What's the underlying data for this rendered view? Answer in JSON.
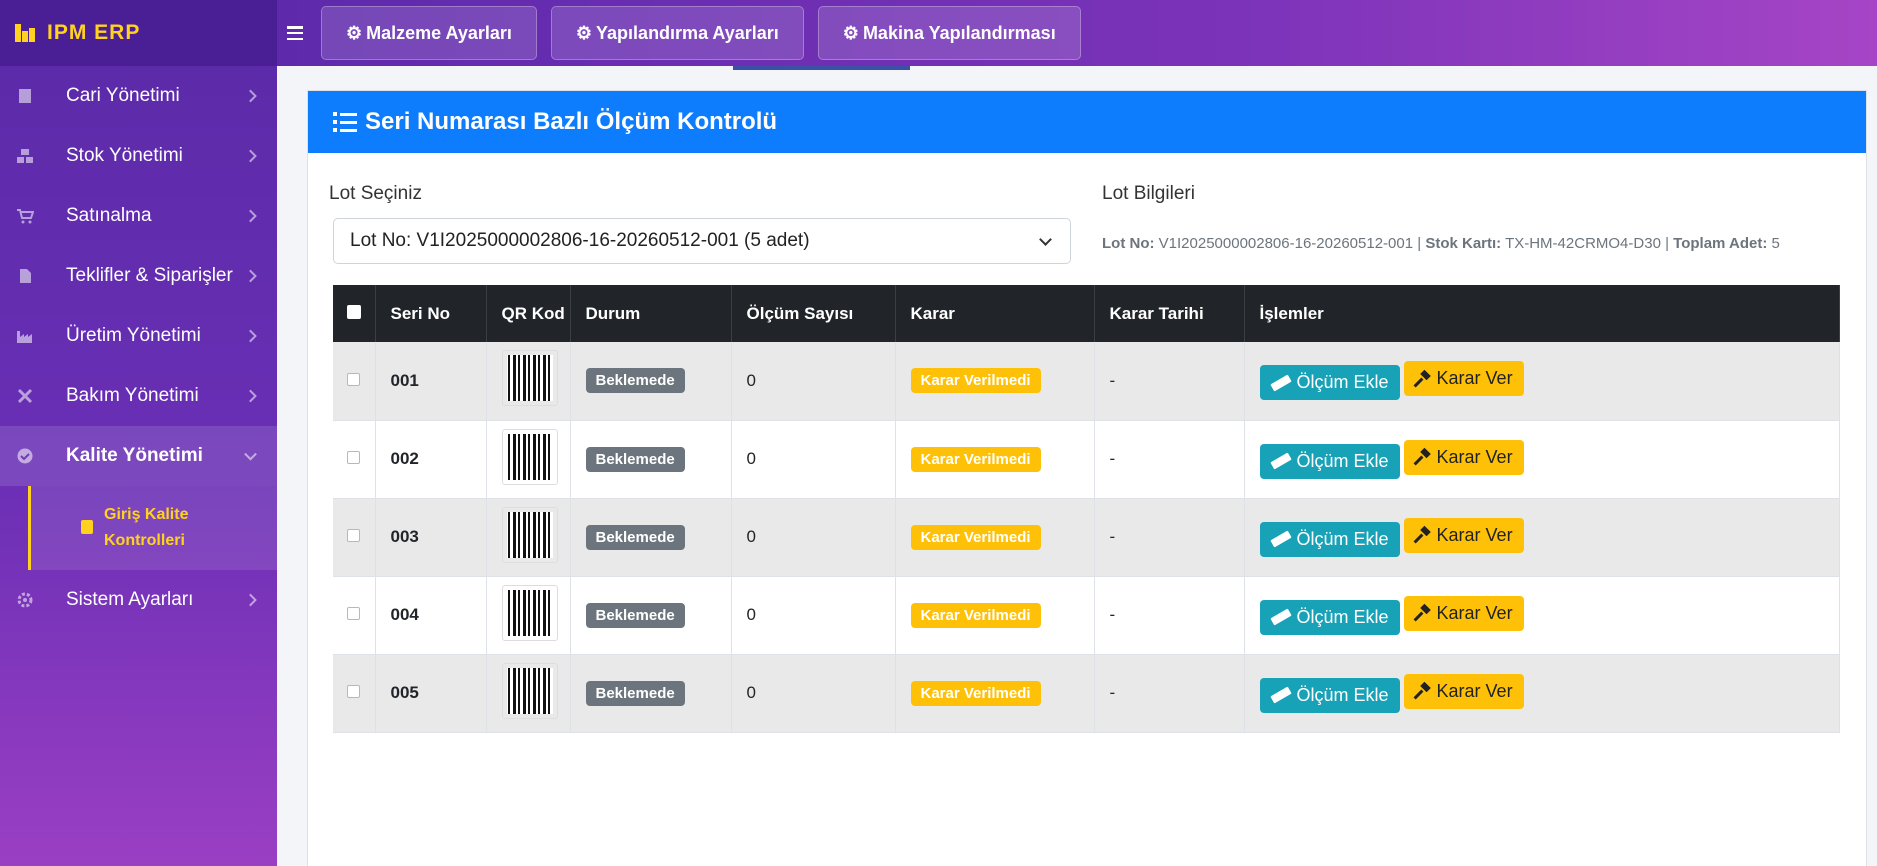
{
  "brand": {
    "name": "IPM ERP"
  },
  "topbar": {
    "buttons": [
      {
        "label": "Malzeme Ayarları",
        "icon": "users-gear-icon"
      },
      {
        "label": "Yapılandırma Ayarları",
        "icon": "gear-icon"
      },
      {
        "label": "Makina Yapılandırması",
        "icon": "gears-icon"
      }
    ]
  },
  "sidebar": {
    "items": [
      {
        "label": "Cari Yönetimi",
        "icon": "building-icon"
      },
      {
        "label": "Stok Yönetimi",
        "icon": "boxes-icon"
      },
      {
        "label": "Satınalma",
        "icon": "cart-icon"
      },
      {
        "label": "Teklifler & Siparişler",
        "icon": "document-icon"
      },
      {
        "label": "Üretim Yönetimi",
        "icon": "factory-icon"
      },
      {
        "label": "Bakım Yönetimi",
        "icon": "tools-icon"
      },
      {
        "label": "Kalite Yönetimi",
        "icon": "check-circle-icon"
      },
      {
        "label": "Sistem Ayarları",
        "icon": "gear-icon"
      }
    ],
    "submenu": {
      "label": "Giriş Kalite Kontrolleri",
      "icon": "clipboard-check-icon"
    }
  },
  "card": {
    "title": "Seri Numarası Bazlı Ölçüm Kontrolü",
    "lot_select_label": "Lot Seçiniz",
    "lot_select_value": "Lot No: V1I2025000002806-16-20260512-001 (5 adet)",
    "lot_info_label": "Lot Bilgileri",
    "lot_info": {
      "lot_no_label": "Lot No:",
      "lot_no": "V1I2025000002806-16-20260512-001",
      "stock_label": "Stok Kartı:",
      "stock": "TX-HM-42CRMO4-D30",
      "total_label": "Toplam Adet:",
      "total": "5",
      "sep": "|"
    }
  },
  "table": {
    "headers": [
      "Seri No",
      "QR Kod",
      "Durum",
      "Ölçüm Sayısı",
      "Karar",
      "Karar Tarihi",
      "İşlemler"
    ],
    "rows": [
      {
        "serial": "001",
        "status": "Beklemede",
        "count": "0",
        "decision": "Karar Verilmedi",
        "date": "-"
      },
      {
        "serial": "002",
        "status": "Beklemede",
        "count": "0",
        "decision": "Karar Verilmedi",
        "date": "-"
      },
      {
        "serial": "003",
        "status": "Beklemede",
        "count": "0",
        "decision": "Karar Verilmedi",
        "date": "-"
      },
      {
        "serial": "004",
        "status": "Beklemede",
        "count": "0",
        "decision": "Karar Verilmedi",
        "date": "-"
      },
      {
        "serial": "005",
        "status": "Beklemede",
        "count": "0",
        "decision": "Karar Verilmedi",
        "date": "-"
      }
    ],
    "actions": {
      "measure_label": "Ölçüm Ekle",
      "decide_label": "Karar Ver"
    }
  },
  "colors": {
    "accent": "#0d7dfd",
    "brand": "#ffd21f",
    "sidebar": "#5a2aa8",
    "info": "#17a2b8",
    "warning": "#ffc107",
    "secondary": "#6c757d"
  }
}
